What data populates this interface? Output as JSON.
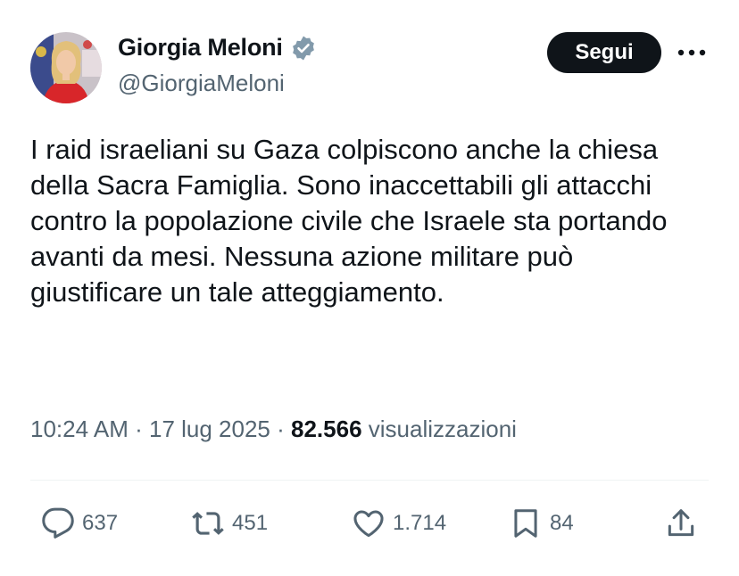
{
  "author": {
    "display_name": "Giorgia Meloni",
    "handle": "@GiorgiaMeloni",
    "verified": true
  },
  "follow_label": "Segui",
  "tweet_text": "I raid israeliani su Gaza colpiscono anche la chiesa della Sacra Famiglia. Sono inaccettabili gli attacchi contro la popolazione civile che Israele sta portando avanti da mesi. Nessuna azione militare può giustificare un tale atteggiamento.",
  "meta": {
    "time": "10:24 AM",
    "date": "17 lug 2025",
    "views_count": "82.566",
    "views_label": "visualizzazioni"
  },
  "actions": {
    "replies": "637",
    "retweets": "451",
    "likes": "1.714",
    "bookmarks": "84"
  },
  "colors": {
    "text": "#0f1419",
    "secondary": "#536471",
    "verified_badge": "#829aab",
    "follow_bg": "#0f1419"
  }
}
